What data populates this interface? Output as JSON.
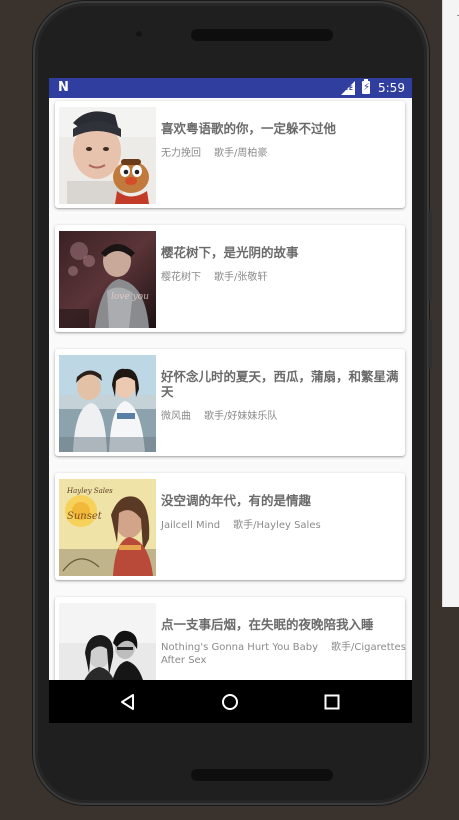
{
  "status_bar": {
    "notification_icon": "N",
    "network": "LTE",
    "battery_icon": "battery-charging-icon",
    "time": "5:59",
    "color": "#303f9f"
  },
  "songs": [
    {
      "title": "喜欢粤语歌的你，一定躲不过他",
      "song": "无力挽回",
      "artist": "歌手/周柏豪",
      "cover": "cover-boy-with-puppet"
    },
    {
      "title": "樱花树下，是光阴的故事",
      "song": "樱花树下",
      "artist": "歌手/张敬轩",
      "cover": "cover-dark-portrait"
    },
    {
      "title": "好怀念儿时的夏天，西瓜，蒲扇，和繁星满天",
      "song": "微风曲",
      "artist": "歌手/好妹妹乐队",
      "cover": "cover-two-students"
    },
    {
      "title": "没空调的年代，有的是情趣",
      "song": "Jailcell Mind",
      "artist": "歌手/Hayley Sales",
      "cover": "cover-hayley-sales"
    },
    {
      "title": "点一支事后烟，在失眠的夜晚陪我入睡",
      "song": "Nothing's Gonna Hurt You Baby",
      "artist": "歌手/Cigarettes After Sex",
      "cover": "cover-black-white-couple"
    }
  ],
  "nav_bar": {
    "back": "back-icon",
    "home": "home-icon",
    "recents": "recents-icon"
  }
}
